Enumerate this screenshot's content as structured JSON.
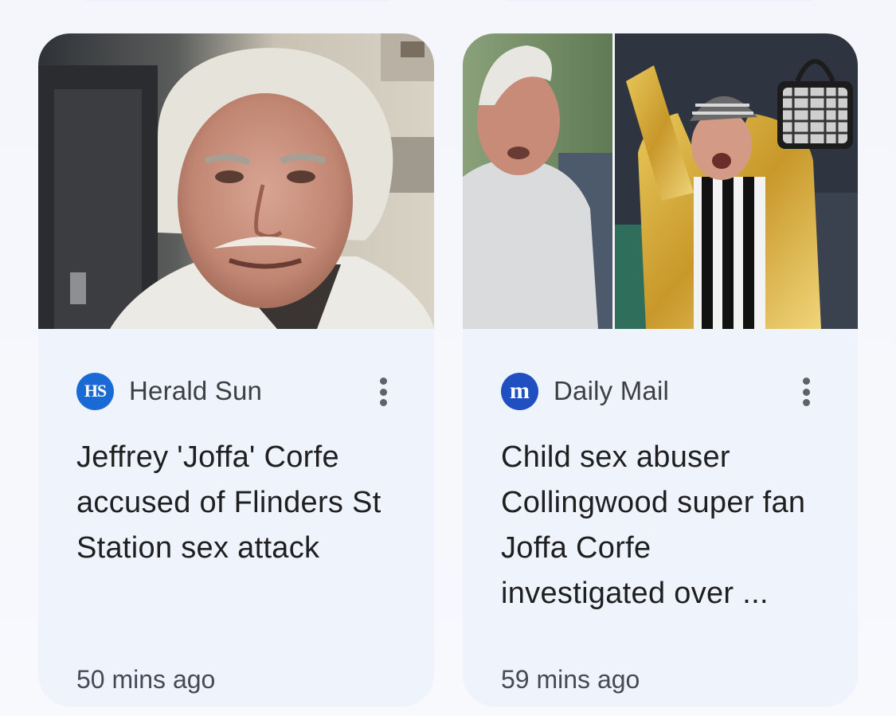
{
  "cards": [
    {
      "source": "Herald Sun",
      "logo_text": "HS",
      "headline": "Jeffrey 'Joffa' Corfe accused of Flinders St Station sex attack",
      "time": "50 mins ago",
      "image_alt": "Photo of a white-haired man with a moustache"
    },
    {
      "source": "Daily Mail",
      "logo_text": "m",
      "headline": "Child sex abuser Collingwood super fan Joffa Corfe investigated over ...",
      "time": "59 mins ago",
      "image_alt": "Photo of a white-haired man beside a football fan in a gold jacket and striped scarf"
    }
  ],
  "colors": {
    "card_bg": "#eef3fc",
    "herald_sun_logo": "#1a6ad6",
    "daily_mail_logo": "#1f4fc1",
    "headline": "#1f1f1f",
    "meta": "#444b55"
  },
  "icons": {
    "more": "more-vert-icon"
  }
}
